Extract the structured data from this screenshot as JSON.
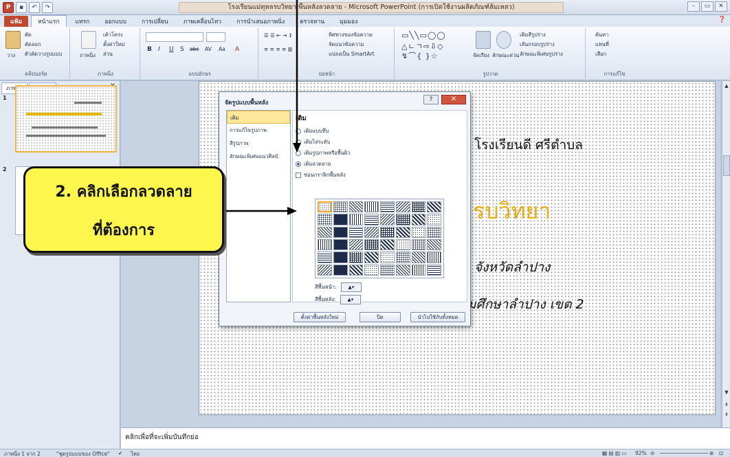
{
  "window": {
    "title": "โรงเรียนแม่ทุหลรบวิทยา พื้นหลังลวดลาย - Microsoft PowerPoint (การเปิดใช้งานผลิตภัณฑ์ล้มเหลว)",
    "qat": [
      "P",
      "save",
      "undo",
      "redo"
    ],
    "controls": [
      "–",
      "▭",
      "✕"
    ]
  },
  "tabs": [
    "แฟ้ม",
    "หน้าแรก",
    "แทรก",
    "ออกแบบ",
    "การเปลี่ยน",
    "ภาพเคลื่อนไหว",
    "การนำเสนอภาพนิ่ง",
    "ตรวจทาน",
    "มุมมอง"
  ],
  "ribbon": {
    "clipboard": {
      "label": "คลิปบอร์ด",
      "paste": "วาง",
      "cut": "ตัด",
      "copy": "คัดลอก",
      "format_painter": "ตัวคัดวางรูปแบบ"
    },
    "slides": {
      "label": "ภาพนิ่ง",
      "new_slide": "ภาพนิ่ง",
      "layout": "เค้าโครง",
      "reset": "ตั้งค่าใหม่",
      "section": "ส่วน"
    },
    "font": {
      "label": "แบบอักษร",
      "buttons": [
        "B",
        "I",
        "U",
        "S",
        "abc",
        "AV",
        "Aa",
        "A"
      ]
    },
    "paragraph": {
      "label": "ย่อหน้า",
      "text_direction": "ทิศทางของข้อความ",
      "align_text": "จัดแนวข้อความ",
      "smartart": "แปลงเป็น SmartArt"
    },
    "drawing": {
      "label": "รูปวาด",
      "arrange": "จัดเรียง",
      "quick_styles": "ลักษณะด่วน",
      "shape_fill": "เติมสีรูปร่าง",
      "shape_outline": "เส้นกรอบรูปร่าง",
      "shape_effects": "ลักษณะพิเศษรูปร่าง"
    },
    "editing": {
      "label": "การแก้ไข",
      "find": "ค้นหา",
      "replace": "แทนที่",
      "select": "เลือก"
    }
  },
  "leftpane": {
    "tabs": [
      "ภาพนิ่ง",
      "เค้าร่าง"
    ],
    "close": "×",
    "slide_numbers": [
      "1",
      "2"
    ]
  },
  "slide": {
    "line1": "โรงเรียนดี ศรีตำบล",
    "line2": "รบวิทยา",
    "line3": "จังหวัดลำปาง",
    "line4": "มศึกษาลำปาง เขต 2"
  },
  "dialog": {
    "title": "จัดรูปแบบพื้นหลัง",
    "help": "?",
    "close": "✕",
    "categories": [
      "เติม",
      "การแก้ไขรูปภาพ",
      "สีรูปภาพ",
      "ลักษณะพิเศษแนวศิลป์"
    ],
    "panel_title": "เติม",
    "options": [
      "เติมแบบทึบ",
      "เติมไล่ระดับ",
      "เติมรูปภาพหรือพื้นผิว",
      "เติมลวดลาย",
      "ซ่อนกราฟิกพื้นหลัง"
    ],
    "fore_color_label": "สีพื้นหน้า:",
    "back_color_label": "สีพื้นหลัง:",
    "buttons": [
      "ตั้งค่าพื้นหลังใหม่",
      "ปิด",
      "นำไปใช้กับทั้งหมด"
    ]
  },
  "callout": {
    "line1": "2. คลิกเลือกลวดลาย",
    "line2": "ที่ต้องการ"
  },
  "notes": {
    "placeholder": "คลิกเพื่อที่จะเพิ่มบันทึกย่อ"
  },
  "statusbar": {
    "slide_info": "ภาพนิ่ง 1 จาก 2",
    "theme": "\"ชุดรูปแบบของ Office\"",
    "language": "ไทย",
    "zoom": "92%"
  },
  "colors": {
    "accent_file_tab": "#c0482e",
    "callout_fill": "#fdf74d",
    "slide_title_gold": "#e7ae10",
    "selection_orange": "#f0a21c"
  }
}
